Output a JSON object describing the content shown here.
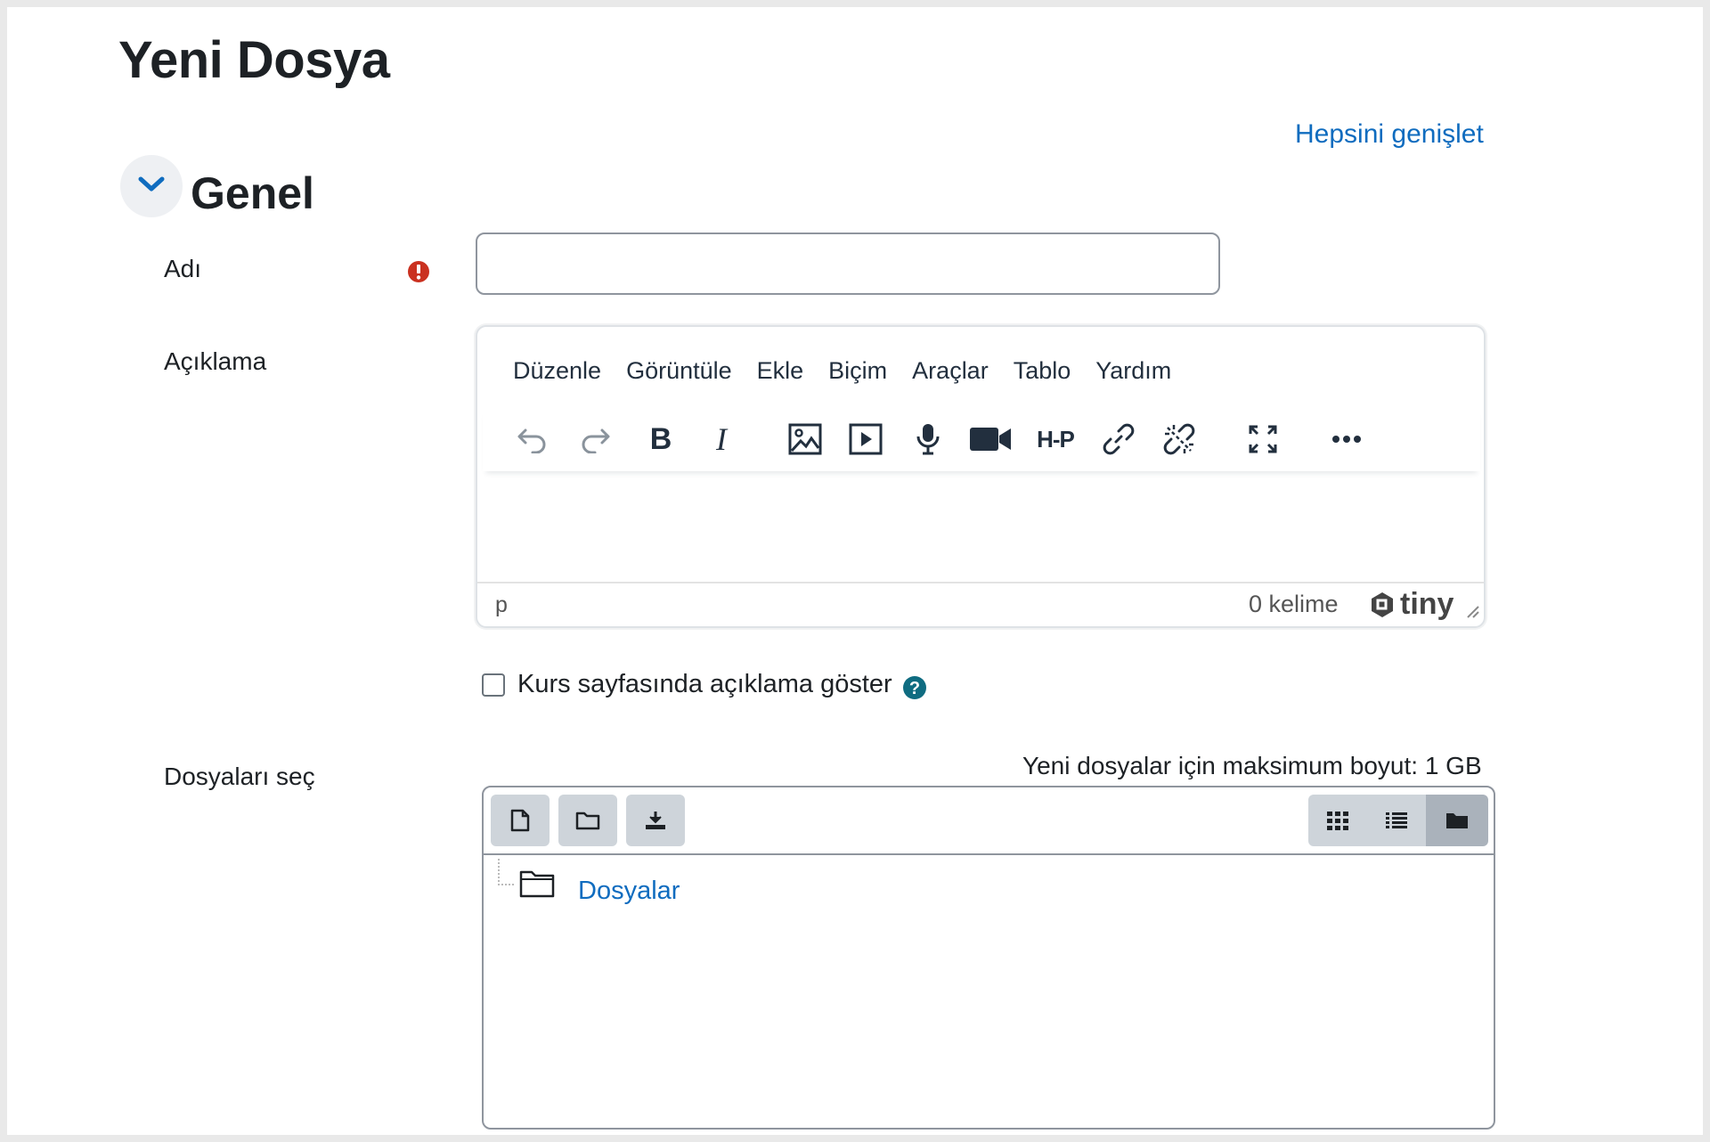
{
  "page": {
    "title": "Yeni Dosya",
    "expand_all": "Hepsini genişlet"
  },
  "section": {
    "title": "Genel"
  },
  "fields": {
    "name": {
      "label": "Adı",
      "value": ""
    },
    "description": {
      "label": "Açıklama"
    },
    "show_description": {
      "label": "Kurs sayfasında açıklama göster",
      "checked": false
    },
    "select_files": {
      "label": "Dosyaları seç",
      "max_size": "Yeni dosyalar için maksimum boyut: 1 GB"
    }
  },
  "editor": {
    "menu": [
      "Düzenle",
      "Görüntüle",
      "Ekle",
      "Biçim",
      "Araçlar",
      "Tablo",
      "Yardım"
    ],
    "toolbar_icons": [
      "undo-icon",
      "redo-icon",
      "bold-icon",
      "italic-icon",
      "image-icon",
      "media-icon",
      "microphone-icon",
      "video-camera-icon",
      "h5p-icon",
      "link-icon",
      "unlink-icon",
      "fullscreen-icon",
      "more-icon"
    ],
    "bold_glyph": "B",
    "italic_glyph": "I",
    "h5p_glyph": "H-P",
    "status_path": "p",
    "word_count": "0 kelime",
    "brand": "tiny"
  },
  "file_manager": {
    "buttons": [
      "new-file-icon",
      "new-folder-icon",
      "download-icon"
    ],
    "views": [
      "grid-view-icon",
      "list-view-icon",
      "tree-view-icon"
    ],
    "active_view": "tree-view-icon",
    "root_folder": "Dosyalar"
  },
  "colors": {
    "link": "#0f6cbf",
    "required": "#ca3120",
    "help": "#0f6c81"
  }
}
